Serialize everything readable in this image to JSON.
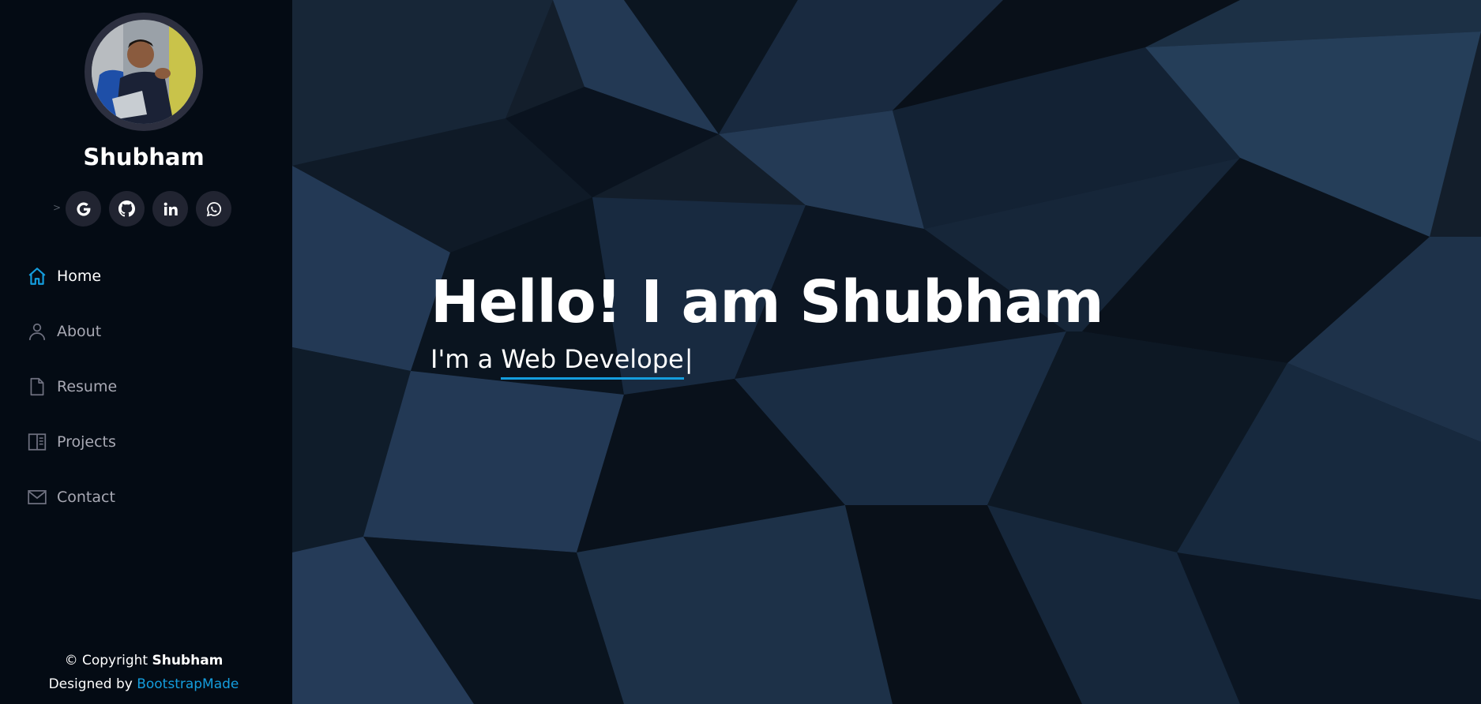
{
  "profile": {
    "name": "Shubham",
    "social_prefix": ">",
    "social": [
      {
        "icon": "google-icon"
      },
      {
        "icon": "github-icon"
      },
      {
        "icon": "linkedin-icon"
      },
      {
        "icon": "whatsapp-icon"
      }
    ]
  },
  "nav": {
    "items": [
      {
        "label": "Home",
        "icon": "home-icon",
        "active": true
      },
      {
        "label": "About",
        "icon": "person-icon",
        "active": false
      },
      {
        "label": "Resume",
        "icon": "file-icon",
        "active": false
      },
      {
        "label": "Projects",
        "icon": "book-icon",
        "active": false
      },
      {
        "label": "Contact",
        "icon": "envelope-icon",
        "active": false
      }
    ]
  },
  "footer": {
    "copyright_prefix": "© Copyright",
    "copyright_name": "Shubham",
    "designed_prefix": "Designed by",
    "designed_link": "BootstrapMade"
  },
  "hero": {
    "title": "Hello! I am Shubham",
    "subtitle_prefix": "I'm a",
    "typed_text": "Web Develope",
    "cursor": "|"
  },
  "colors": {
    "accent": "#149ddd",
    "sidebar_bg": "#040b14",
    "social_bg": "#212431",
    "nav_text": "#a8a9b4"
  }
}
